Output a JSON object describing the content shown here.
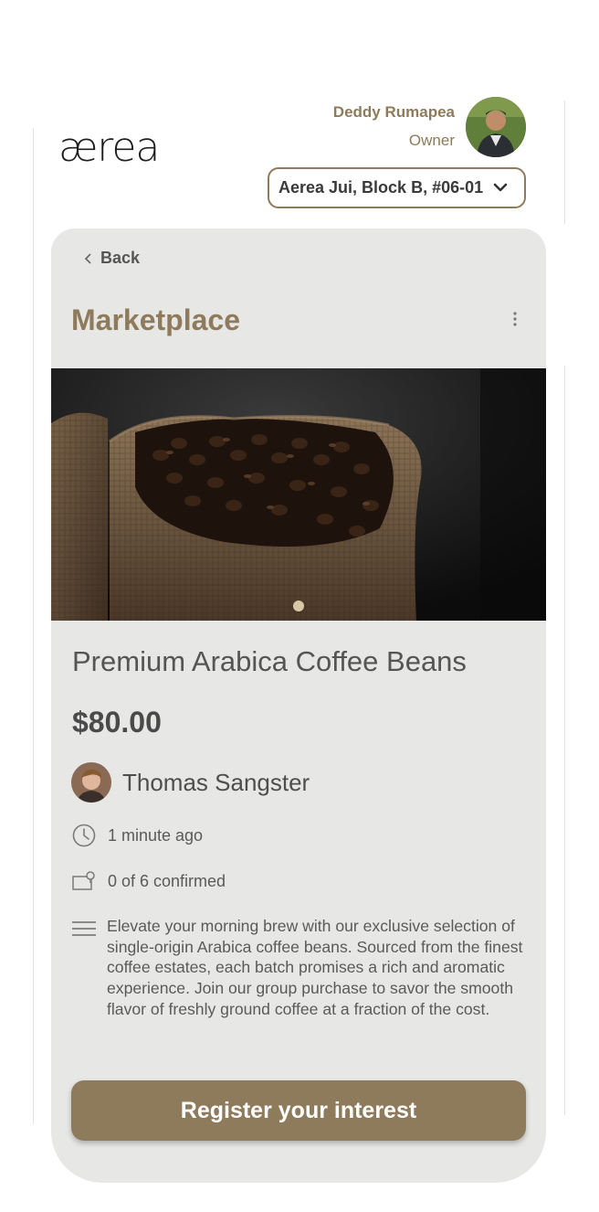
{
  "brand": {
    "logo_text": "ærea"
  },
  "user": {
    "name": "Deddy Rumapea",
    "role": "Owner"
  },
  "unit_selector": {
    "value": "Aerea Jui, Block B, #06-01"
  },
  "nav": {
    "back_label": "Back"
  },
  "page": {
    "title": "Marketplace"
  },
  "listing": {
    "title": "Premium Arabica Coffee Beans",
    "price": "$80.00",
    "seller": {
      "name": "Thomas Sangster"
    },
    "posted": "1 minute ago",
    "confirmed": "0 of 6 confirmed",
    "description": "Elevate your morning brew with our exclusive selection of single-origin Arabica coffee beans. Sourced from the finest coffee estates, each batch promises a rich and aromatic experience. Join our group purchase to savor the smooth flavor of freshly ground coffee at a fraction of the cost.",
    "image_count": 1,
    "current_image": 1
  },
  "actions": {
    "register_label": "Register your interest"
  },
  "icons": [
    "chevron-left-icon",
    "chevron-down-icon",
    "kebab-menu-icon",
    "clock-icon",
    "confirmed-tag-icon",
    "description-lines-icon"
  ],
  "colors": {
    "accent": "#8e7b5c",
    "card_bg": "#e7e7e6",
    "text": "#555555"
  }
}
